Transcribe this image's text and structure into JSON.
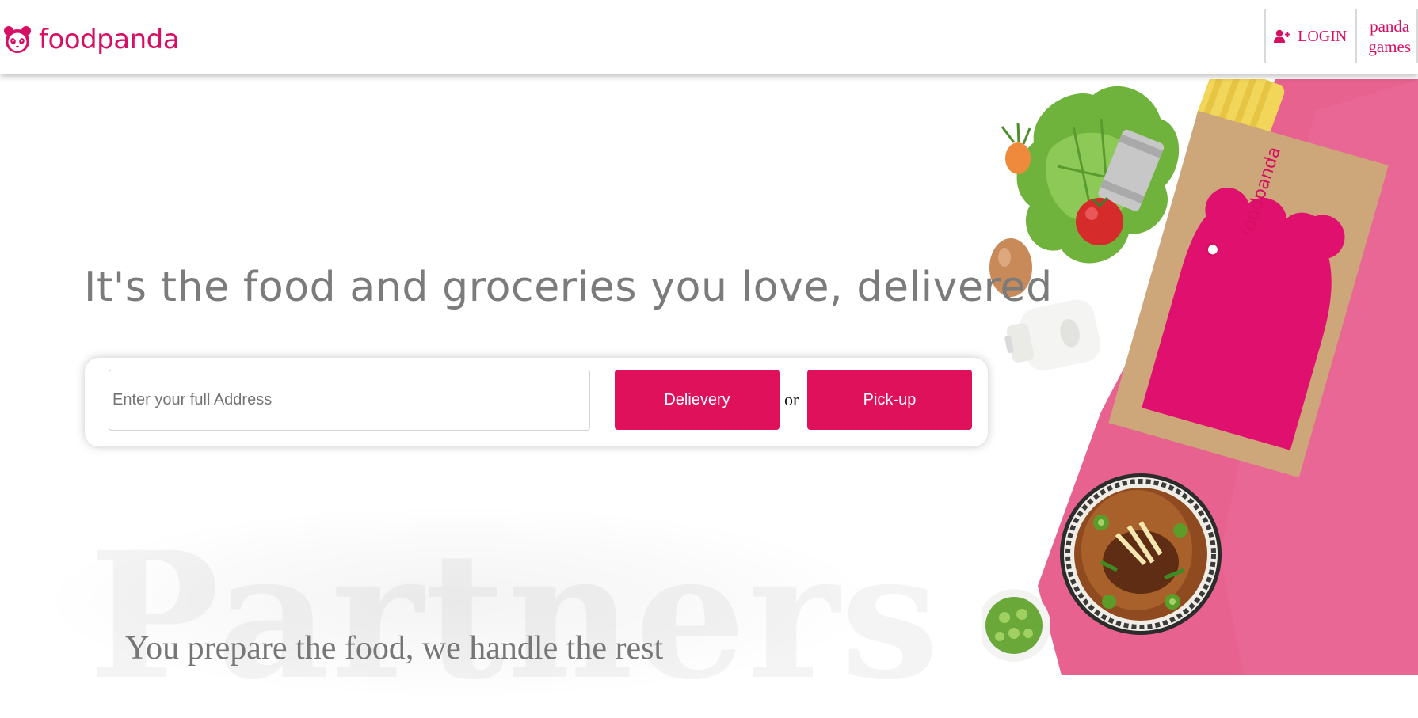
{
  "header": {
    "brand": "foodpanda",
    "login_label": "LOGIN",
    "games_line1": "panda",
    "games_line2": "games"
  },
  "hero": {
    "headline": "It's the food and groceries you love, delivered",
    "address_placeholder": "Enter your full Address",
    "address_value": "",
    "delivery_label": "Delievery",
    "or_label": "or",
    "pickup_label": "Pick-up",
    "bag_brand": "foodpanda"
  },
  "partners": {
    "background_word": "Partners",
    "subtitle": "You prepare the food, we handle the rest"
  },
  "colors": {
    "brand_pink": "#d70f64",
    "button_pink": "#e0115b",
    "headline_gray": "#7b7b7b"
  },
  "icons": [
    "panda-logo-icon",
    "add-user-icon"
  ]
}
